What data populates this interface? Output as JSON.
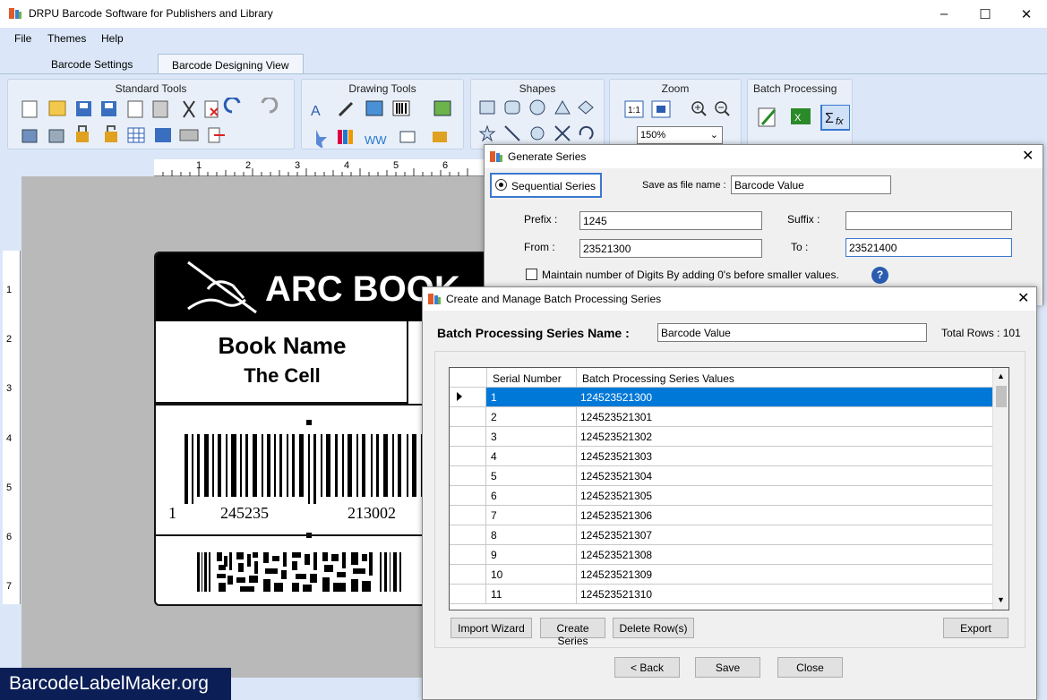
{
  "app": {
    "title": "DRPU Barcode Software for Publishers and Library"
  },
  "menu": [
    "File",
    "Themes",
    "Help"
  ],
  "tabs": [
    "Barcode Settings",
    "Barcode Designing View"
  ],
  "ribbon": {
    "groups": [
      "Standard Tools",
      "Drawing Tools",
      "Shapes",
      "Zoom",
      "Batch Processing"
    ],
    "zoom_value": "150%"
  },
  "ruler": {
    "h": [
      "1",
      "2",
      "3",
      "4",
      "5",
      "6"
    ],
    "v": [
      "1",
      "2",
      "3",
      "4",
      "5",
      "6",
      "7"
    ]
  },
  "label": {
    "header": "ARC BOOK",
    "book_name": "Book Name",
    "book_title": "The Cell",
    "barcode_digits": [
      "1",
      "245235",
      "213002"
    ]
  },
  "generate": {
    "title": "Generate Series",
    "radio": "Sequential Series",
    "save_label": "Save as file name :",
    "save_value": "Barcode Value",
    "prefix_label": "Prefix :",
    "prefix_value": "1245",
    "suffix_label": "Suffix :",
    "suffix_value": "",
    "from_label": "From :",
    "from_value": "23521300",
    "to_label": "To :",
    "to_value": "23521400",
    "maintain": "Maintain number of Digits By adding 0's before smaller values."
  },
  "batch": {
    "title": "Create and Manage Batch Processing Series",
    "name_label": "Batch Processing Series Name :",
    "name_value": "Barcode Value",
    "total_rows": "Total Rows : 101",
    "col_serial": "Serial Number",
    "col_values": "Batch Processing Series Values",
    "rows": [
      [
        "1",
        "124523521300"
      ],
      [
        "2",
        "124523521301"
      ],
      [
        "3",
        "124523521302"
      ],
      [
        "4",
        "124523521303"
      ],
      [
        "5",
        "124523521304"
      ],
      [
        "6",
        "124523521305"
      ],
      [
        "7",
        "124523521306"
      ],
      [
        "8",
        "124523521307"
      ],
      [
        "9",
        "124523521308"
      ],
      [
        "10",
        "124523521309"
      ],
      [
        "11",
        "124523521310"
      ]
    ],
    "buttons": {
      "import": "Import Wizard",
      "create": "Create Series",
      "delete": "Delete Row(s)",
      "export": "Export",
      "back": "< Back",
      "save": "Save",
      "close": "Close"
    }
  },
  "watermark": "BarcodeLabelMaker.org"
}
